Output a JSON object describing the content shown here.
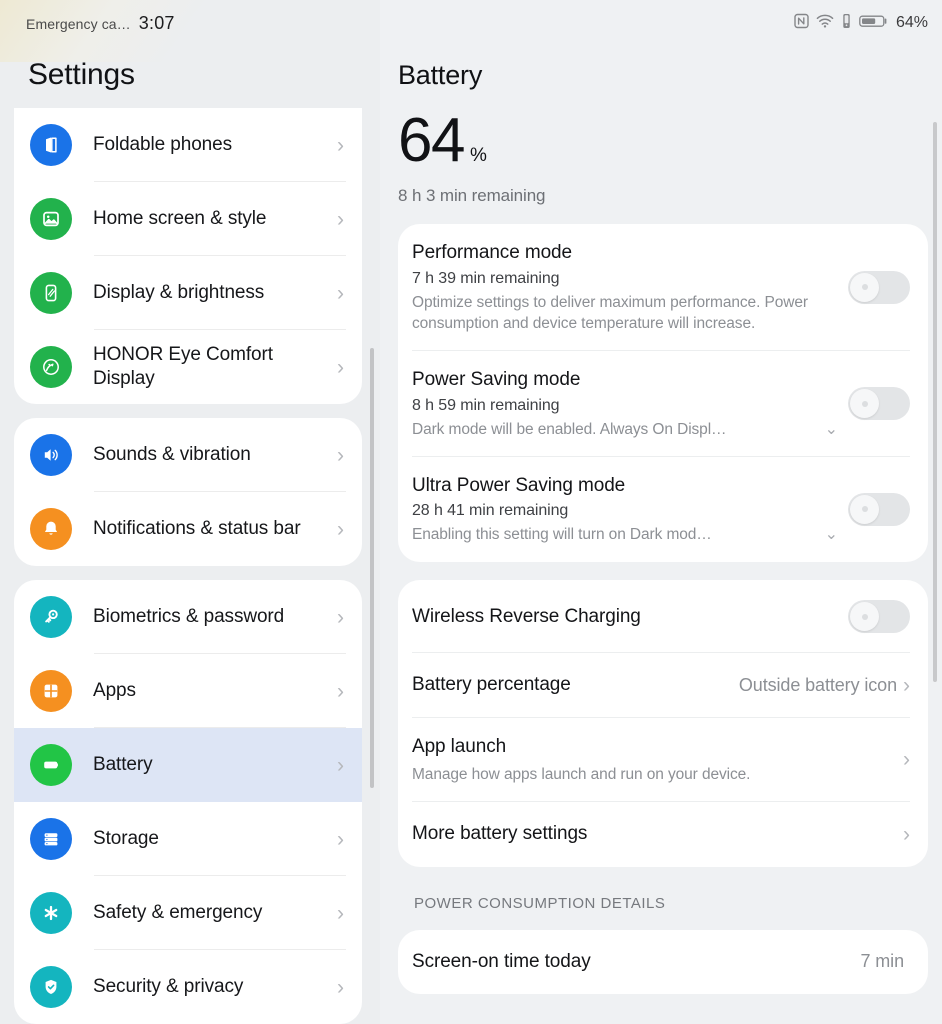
{
  "statusbar": {
    "carrier": "Emergency ca…",
    "clock": "3:07",
    "battery_percent": "64%",
    "icons": [
      "nfc-icon",
      "wifi-icon",
      "vibrate-icon",
      "battery-icon"
    ]
  },
  "sidebar": {
    "title": "Settings",
    "groups": [
      {
        "items": [
          {
            "label": "Foldable phones",
            "icon": "foldable-phone-icon",
            "icon_color": "#1a73e8",
            "selected": false
          },
          {
            "label": "Home screen & style",
            "icon": "image-icon",
            "icon_color": "#22b24c",
            "selected": false
          },
          {
            "label": "Display & brightness",
            "icon": "display-brightness-icon",
            "icon_color": "#22b24c",
            "selected": false
          },
          {
            "label": "HONOR Eye Comfort Display",
            "icon": "eye-comfort-icon",
            "icon_color": "#22b24c",
            "selected": false
          }
        ]
      },
      {
        "items": [
          {
            "label": "Sounds & vibration",
            "icon": "speaker-icon",
            "icon_color": "#1a73e8",
            "selected": false
          },
          {
            "label": "Notifications & status bar",
            "icon": "bell-icon",
            "icon_color": "#f59020",
            "selected": false
          }
        ]
      },
      {
        "items": [
          {
            "label": "Biometrics & password",
            "icon": "key-icon",
            "icon_color": "#14b5bf",
            "selected": false
          },
          {
            "label": "Apps",
            "icon": "apps-grid-icon",
            "icon_color": "#f59020",
            "selected": false
          },
          {
            "label": "Battery",
            "icon": "battery-icon",
            "icon_color": "#22c546",
            "selected": true
          },
          {
            "label": "Storage",
            "icon": "storage-icon",
            "icon_color": "#1a73e8",
            "selected": false
          },
          {
            "label": "Safety & emergency",
            "icon": "asterisk-icon",
            "icon_color": "#14b5bf",
            "selected": false
          },
          {
            "label": "Security & privacy",
            "icon": "shield-check-icon",
            "icon_color": "#14b5bf",
            "selected": false
          }
        ]
      }
    ]
  },
  "main": {
    "title": "Battery",
    "percent_value": "64",
    "percent_unit": "%",
    "remaining": "8 h 3 min remaining",
    "modes": [
      {
        "title": "Performance mode",
        "remaining": "7 h 39 min remaining",
        "description": "Optimize settings to deliver maximum performance. Power consumption and device temperature will increase.",
        "toggle_state": "off",
        "expandable": false
      },
      {
        "title": "Power Saving mode",
        "remaining": "8 h 59 min remaining",
        "description": "Dark mode will be enabled. Always On Displ…",
        "toggle_state": "off",
        "expandable": true
      },
      {
        "title": "Ultra Power Saving mode",
        "remaining": "28 h 41 min remaining",
        "description": "Enabling this setting will turn on Dark mod…",
        "toggle_state": "off",
        "expandable": true
      }
    ],
    "settings": [
      {
        "title": "Wireless Reverse Charging",
        "type": "toggle",
        "toggle_state": "off"
      },
      {
        "title": "Battery percentage",
        "type": "value",
        "value": "Outside battery icon"
      },
      {
        "title": "App launch",
        "type": "link",
        "description": "Manage how apps launch and run on your device."
      },
      {
        "title": "More battery settings",
        "type": "link"
      }
    ],
    "section_header": "POWER CONSUMPTION DETAILS",
    "consumption": [
      {
        "title": "Screen-on time today",
        "value": "7 min"
      }
    ]
  }
}
